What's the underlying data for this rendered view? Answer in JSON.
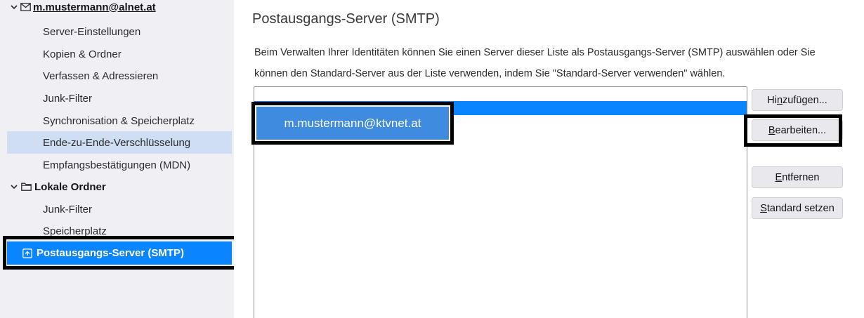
{
  "sidebar": {
    "account_label": "m.mustermann@alnet.at",
    "account_items": [
      {
        "label": "Server-Einstellungen"
      },
      {
        "label": "Kopien & Ordner"
      },
      {
        "label": "Verfassen & Adressieren"
      },
      {
        "label": "Junk-Filter"
      },
      {
        "label": "Synchronisation & Speicherplatz"
      },
      {
        "label": "Ende-zu-Ende-Verschlüsselung"
      },
      {
        "label": "Empfangsbestätigungen (MDN)"
      }
    ],
    "local_folders_label": "Lokale Ordner",
    "local_items": [
      {
        "label": "Junk-Filter"
      },
      {
        "label": "Speicherplatz"
      }
    ],
    "smtp_label": "Postausgangs-Server (SMTP)"
  },
  "main": {
    "title": "Postausgangs-Server (SMTP)",
    "description_line1": "Beim Verwalten Ihrer Identitäten können Sie einen Server dieser Liste als Postausgangs-Server (SMTP) auswählen oder Sie",
    "description_line2": "können den Standard-Server aus der Liste verwenden, indem Sie \"Standard-Server verwenden\" wählen.",
    "server_entry": "m.mustermann@ktvnet.at"
  },
  "buttons": {
    "add": {
      "pre": "Hi",
      "key": "n",
      "post": "zufügen..."
    },
    "edit": {
      "pre": "",
      "key": "B",
      "post": "earbeiten..."
    },
    "remove": {
      "pre": "",
      "key": "E",
      "post": "ntfernen"
    },
    "set_default": {
      "pre": "",
      "key": "S",
      "post": "tandard setzen"
    }
  },
  "colors": {
    "accent": "#0a84ff",
    "selected_item": "#cfdef3",
    "sidebar_bg": "#f0f0f4",
    "highlight_frame": "#000000"
  }
}
